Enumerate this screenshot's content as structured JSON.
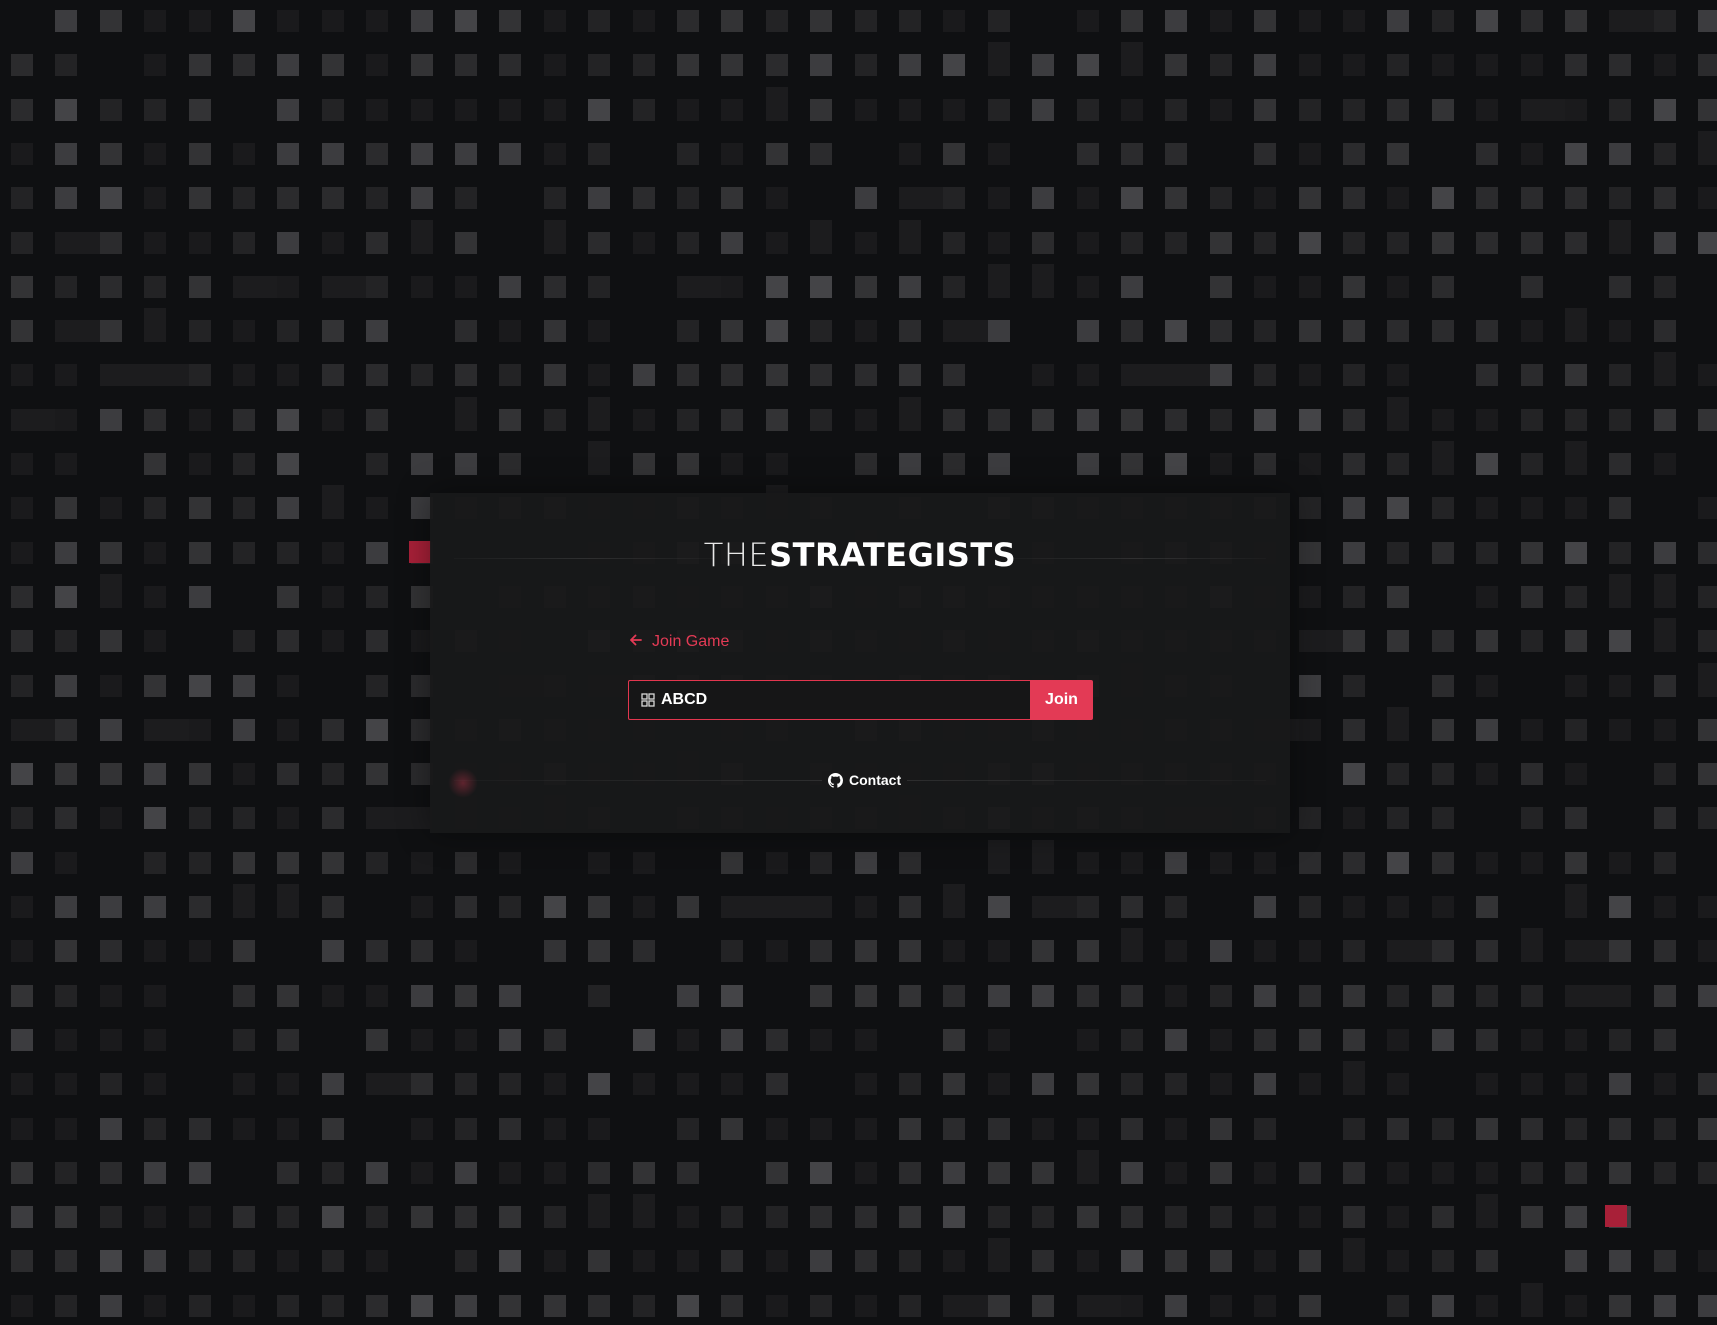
{
  "brand": {
    "logo_prefix": "THE",
    "logo_main": "STRATEGISTS"
  },
  "join": {
    "back_label": "Join Game",
    "code_value": "ABCD",
    "code_placeholder": "",
    "join_label": "Join"
  },
  "footer": {
    "contact_label": "Contact"
  },
  "colors": {
    "accent": "#e33a55",
    "background": "#0f1012",
    "card": "#181819",
    "tile_bright": "#3c3c3f",
    "tile_mid": "#2a2a2c",
    "tile_dim": "#1a1a1c"
  },
  "icons": {
    "back": "arrow-left-icon",
    "code": "grid-icon",
    "contact": "github-icon"
  }
}
